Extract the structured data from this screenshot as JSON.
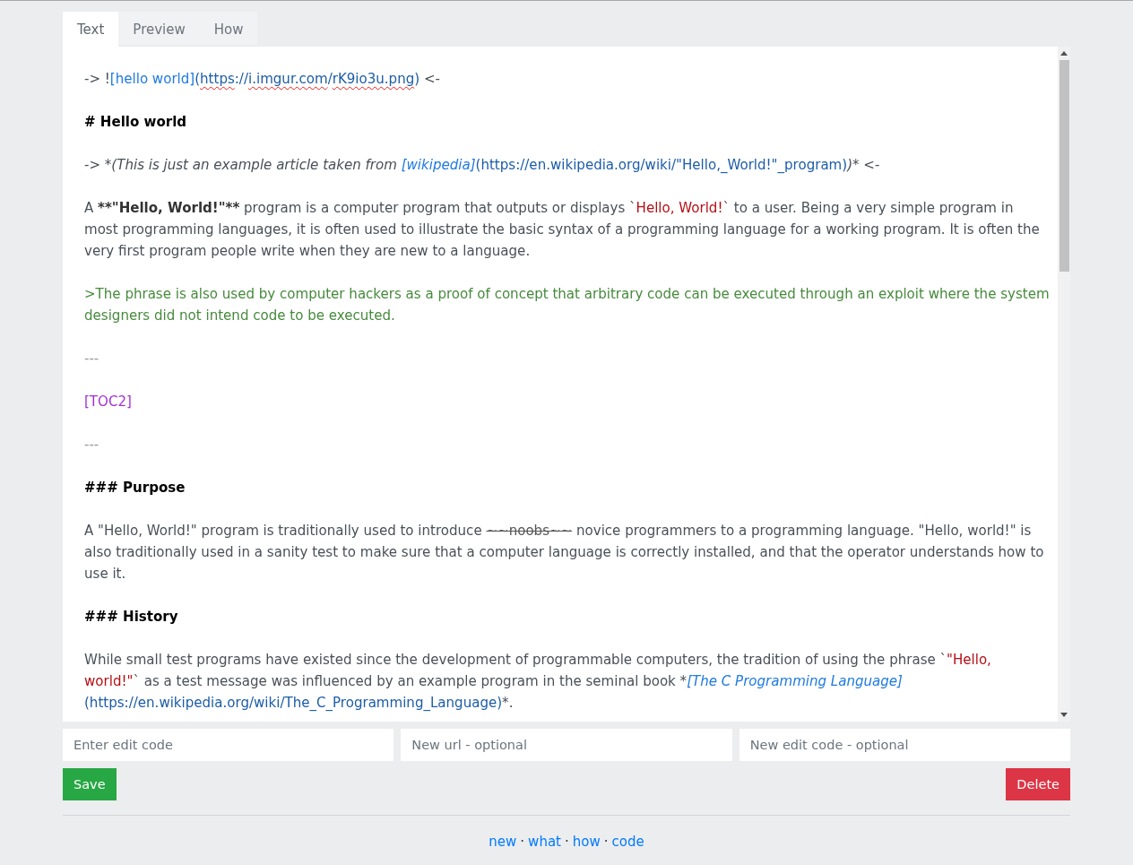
{
  "tabs": [
    {
      "label": "Text",
      "selected": true
    },
    {
      "label": "Preview",
      "selected": false
    },
    {
      "label": "How",
      "selected": false
    }
  ],
  "editor": {
    "blocks": [
      {
        "segments": [
          {
            "kind": "plain",
            "text": "-> !"
          },
          {
            "kind": "link_text",
            "text": "[hello world]"
          },
          {
            "kind": "url",
            "text": "("
          },
          {
            "kind": "url_misspelled",
            "text": "https"
          },
          {
            "kind": "url",
            "text": "://"
          },
          {
            "kind": "url_misspelled",
            "text": "i.imgur.com"
          },
          {
            "kind": "url",
            "text": "/"
          },
          {
            "kind": "url_misspelled",
            "text": "rK9io3u.png"
          },
          {
            "kind": "url",
            "text": ")"
          },
          {
            "kind": "plain",
            "text": " <-"
          }
        ]
      },
      {
        "segments": [
          {
            "kind": "heading",
            "text": "# Hello world"
          }
        ]
      },
      {
        "segments": [
          {
            "kind": "plain",
            "text": "-> "
          },
          {
            "kind": "italic",
            "text": "*(This is just an example article taken from "
          },
          {
            "kind": "italic_link",
            "text": "[wikipedia]"
          },
          {
            "kind": "url",
            "text": "(https://en.wikipedia.org/wiki/\"Hello,_World!\"_program)"
          },
          {
            "kind": "italic",
            "text": ")*"
          },
          {
            "kind": "plain",
            "text": " <-"
          }
        ]
      },
      {
        "segments": [
          {
            "kind": "plain",
            "text": "A "
          },
          {
            "kind": "bold",
            "text": "**"
          },
          {
            "kind": "bold",
            "text": "\"Hello, World!\""
          },
          {
            "kind": "bold",
            "text": "**"
          },
          {
            "kind": "plain",
            "text": " program is a computer program that outputs or displays "
          },
          {
            "kind": "code_mark",
            "text": "`"
          },
          {
            "kind": "code",
            "text": "Hello, World!"
          },
          {
            "kind": "code_mark",
            "text": "`"
          },
          {
            "kind": "plain",
            "text": " to a user. Being a very simple program in most programming languages, it is often used to illustrate the basic syntax of a programming language for a working program. It is often the very first program people write when they are new to a language."
          }
        ]
      },
      {
        "segments": [
          {
            "kind": "quote",
            "text": ">The phrase is also used by computer hackers as a proof of concept that arbitrary code can be executed through an exploit where the system designers did not intend code to be executed."
          }
        ]
      },
      {
        "segments": [
          {
            "kind": "rule",
            "text": "---"
          }
        ]
      },
      {
        "segments": [
          {
            "kind": "toc",
            "text": "[TOC2]"
          }
        ]
      },
      {
        "segments": [
          {
            "kind": "rule",
            "text": "---"
          }
        ]
      },
      {
        "segments": [
          {
            "kind": "heading",
            "text": "### Purpose"
          }
        ]
      },
      {
        "segments": [
          {
            "kind": "plain",
            "text": "A \"Hello, World!\" program is traditionally used to introduce "
          },
          {
            "kind": "strike",
            "text": "~~noobs~~"
          },
          {
            "kind": "plain",
            "text": " novice programmers to a programming language. \"Hello, world!\" is also traditionally used in a sanity test to make sure that a computer language is correctly installed, and that the operator understands how to use it."
          }
        ]
      },
      {
        "segments": [
          {
            "kind": "heading",
            "text": "### History"
          }
        ]
      },
      {
        "segments": [
          {
            "kind": "plain",
            "text": "While small test programs have existed since the development of programmable computers, the tradition of using the phrase "
          },
          {
            "kind": "code_mark",
            "text": "`"
          },
          {
            "kind": "code",
            "text": "\"Hello, world!\""
          },
          {
            "kind": "code_mark",
            "text": "`"
          },
          {
            "kind": "plain",
            "text": " as a test message was influenced by an example program in the seminal book "
          },
          {
            "kind": "italic",
            "text": "*"
          },
          {
            "kind": "italic_link",
            "text": "[The C Programming Language]"
          },
          {
            "kind": "url",
            "text": "(https://en.wikipedia.org/wiki/The_C_Programming_Language)"
          },
          {
            "kind": "plain",
            "text": "*."
          }
        ]
      }
    ]
  },
  "fields": [
    {
      "placeholder": "Enter edit code"
    },
    {
      "placeholder": "New url - optional"
    },
    {
      "placeholder": "New edit code - optional"
    }
  ],
  "buttons": [
    {
      "kind": "save",
      "label": "Save"
    },
    {
      "kind": "delete",
      "label": "Delete"
    }
  ],
  "footer": {
    "items": [
      {
        "kind": "link",
        "text": "new"
      },
      {
        "kind": "separator",
        "text": "·"
      },
      {
        "kind": "link",
        "text": "what"
      },
      {
        "kind": "separator",
        "text": "·"
      },
      {
        "kind": "link",
        "text": "how"
      },
      {
        "kind": "separator",
        "text": "·"
      },
      {
        "kind": "link",
        "text": "code"
      }
    ]
  }
}
